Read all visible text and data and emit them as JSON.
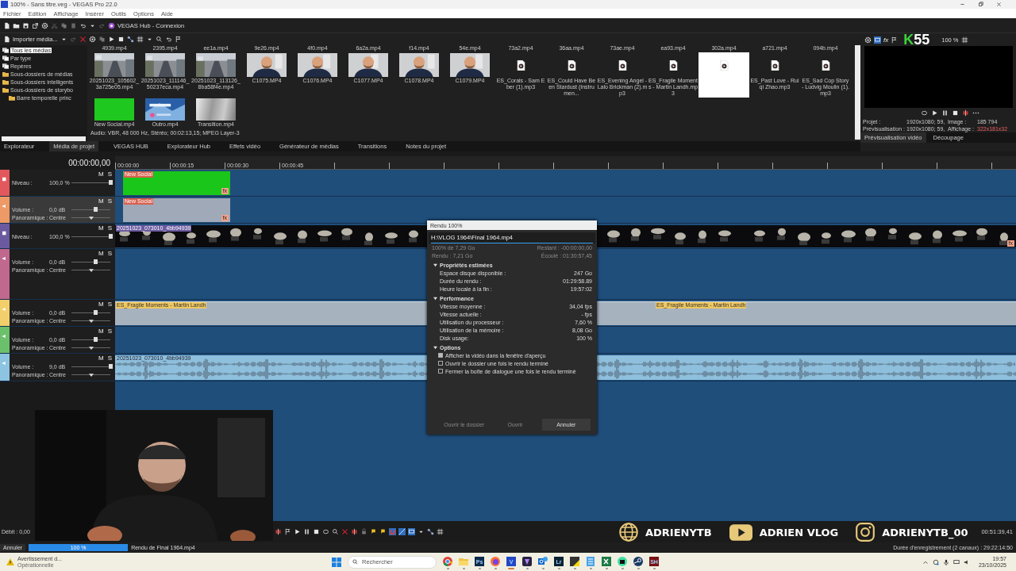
{
  "window": {
    "title": "100% - Sans titre.veg - VEGAS Pro 22.0"
  },
  "menu": [
    "Fichier",
    "Edition",
    "Affichage",
    "Insérer",
    "Outils",
    "Options",
    "Aide"
  ],
  "hub": {
    "label": "VEGAS Hub - Connexion"
  },
  "media": {
    "import_label": "Importer média...",
    "tree": [
      {
        "label": "Tous les médias",
        "kind": "stack",
        "selected": true
      },
      {
        "label": "Par type",
        "kind": "stack",
        "selected": false
      },
      {
        "label": "Repères",
        "kind": "stack",
        "selected": false
      },
      {
        "label": "Sous-dossiers de médias",
        "kind": "folder",
        "selected": false
      },
      {
        "label": "Sous-dossiers intelligents",
        "kind": "folder",
        "selected": false
      },
      {
        "label": "Sous-dossiers de storybo",
        "kind": "folder",
        "selected": false,
        "children": [
          {
            "label": "Barre temporelle princ",
            "kind": "folder",
            "selected": false
          }
        ]
      }
    ],
    "top_labels": [
      "4939.mp4",
      "2395.mp4",
      "ee1a.mp4",
      "9e26.mp4",
      "4f0.mp4",
      "6a2a.mp4",
      "f14.mp4",
      "54e.mp4",
      "73a2.mp4",
      "36aa.mp4",
      "73ae.mp4",
      "ea93.mp4",
      "302a.mp4",
      "a721.mp4",
      "094b.mp4"
    ],
    "rows": [
      [
        {
          "name": "20251023_105602_3a725e05.mp4",
          "kind": "picture",
          "selected": false
        },
        {
          "name": "20251023_111146_50237eca.mp4",
          "kind": "picture",
          "selected": false
        },
        {
          "name": "20251023_113126_8ba58f4e.mp4",
          "kind": "picture",
          "selected": false
        },
        {
          "name": "C1075.MP4",
          "kind": "picture",
          "selected": false
        },
        {
          "name": "C1076.MP4",
          "kind": "picture",
          "selected": false
        },
        {
          "name": "C1077.MP4",
          "kind": "picture",
          "selected": false
        },
        {
          "name": "C1078.MP4",
          "kind": "picture",
          "selected": false
        },
        {
          "name": "C1079.MP4",
          "kind": "picture",
          "selected": false
        },
        {
          "name": "ES_Corals - Sam Eber (1).mp3",
          "kind": "audio",
          "selected": false
        },
        {
          "name": "ES_Could Have Been Stardust (Instrumen...",
          "kind": "audio",
          "selected": false
        },
        {
          "name": "ES_Evening Angel - Lalo Brickman (2).mp3",
          "kind": "audio",
          "selected": false
        },
        {
          "name": "ES_Fragile Moments - Martin Landh.mp3",
          "kind": "audio",
          "selected": false
        },
        {
          "kind": "audio",
          "selected": true
        },
        {
          "name": "ES_Past Love - Ruiqi Zhao.mp3",
          "kind": "audio",
          "selected": false
        },
        {
          "name": "ES_Sad Cop Story - Ludvig Moulin (1).mp3",
          "kind": "audio",
          "selected": false
        }
      ],
      [
        {
          "name": "New Social.mp4",
          "kind": "solid",
          "color": "#1fc81f",
          "selected": false
        },
        {
          "name": "Outro.mp4",
          "kind": "picture",
          "selected": false
        },
        {
          "name": "Transition.mp4",
          "kind": "fade",
          "selected": false
        }
      ]
    ],
    "info": "Audio: VBR, 48 000 Hz, Stéréo; 00:02:13,15; MPEG Layer-3",
    "tabs": [
      {
        "label": "Explorateur",
        "selected": false
      },
      {
        "label": "Média de projet",
        "selected": true
      },
      {
        "label": "VEGAS HUB",
        "selected": false
      },
      {
        "label": "Explorateur Hub",
        "selected": false
      },
      {
        "label": "Effets vidéo",
        "selected": false
      },
      {
        "label": "Générateur de médias",
        "selected": false
      },
      {
        "label": "Transitions",
        "selected": false
      },
      {
        "label": "Notes du projet",
        "selected": false
      }
    ]
  },
  "preview": {
    "fx_label": "fx",
    "logo_k": "K",
    "logo_num": "55",
    "zoom": "100 %",
    "info": [
      {
        "label": "Projet :",
        "value": "1920x1080; 59,",
        "label2": "Image :",
        "value2": "185 794"
      },
      {
        "label": "Prévisualisation :",
        "value": "1920x1080; 59,",
        "label2": "Affichage :",
        "value2": "322x181x32"
      }
    ],
    "tabs": [
      {
        "label": "Prévisualisation vidéo",
        "selected": true
      },
      {
        "label": "Découpage",
        "selected": false
      }
    ]
  },
  "timeline": {
    "timecode": "00:00:00,00",
    "ruler": [
      "00:00:00",
      "00:00:15",
      "00:00:30",
      "00:00:45"
    ],
    "tracks": [
      {
        "kind": "video",
        "color": "#e2585c",
        "selected": false,
        "buttons": [
          "M",
          "S"
        ],
        "params": [
          {
            "kind": "slider",
            "label": "Niveau :",
            "value": "100,0 %",
            "level": 1
          }
        ],
        "clips": [
          {
            "kind": "solid",
            "name": "New Social",
            "badge": "fx"
          }
        ]
      },
      {
        "kind": "audio",
        "color": "#ee9a66",
        "selected": true,
        "buttons": [
          "M",
          "S"
        ],
        "params": [
          {
            "kind": "slider",
            "label": "Volume :",
            "value": "0,0 dB",
            "level": 0.62
          },
          {
            "kind": "pan",
            "label": "Panoramique :",
            "value": "Centre",
            "level": 0.5
          }
        ],
        "clips": [
          {
            "kind": "audio",
            "name": "New Social",
            "badge": "fx"
          }
        ]
      },
      {
        "kind": "video",
        "color": "#6b5aa0",
        "selected": false,
        "buttons": [
          "M",
          "S"
        ],
        "params": [
          {
            "kind": "slider",
            "label": "Niveau :",
            "value": "100,0 %",
            "level": 1
          }
        ],
        "clips": [
          {
            "kind": "footage",
            "name": "20251023_073010_4bb94939"
          },
          {
            "kind": "footage",
            "badge": "fx"
          }
        ]
      },
      {
        "kind": "audio",
        "color": "#c0688e",
        "selected": false,
        "buttons": [
          "M",
          "S"
        ],
        "params": [
          {
            "kind": "slider",
            "label": "Volume :",
            "value": "0,0 dB",
            "level": 0.62
          },
          {
            "kind": "pan",
            "label": "Panoramique :",
            "value": "Centre",
            "level": 0.5
          }
        ]
      },
      {
        "kind": "audio",
        "color": "#f2cf6a",
        "selected": false,
        "buttons": [
          "M",
          "S"
        ],
        "params": [
          {
            "kind": "slider",
            "label": "Volume :",
            "value": "0,0 dB",
            "level": 0.62
          },
          {
            "kind": "pan",
            "label": "Panoramique :",
            "value": "Centre",
            "level": 0.5
          }
        ],
        "clips": [
          {
            "kind": "music",
            "name": "ES_Fragile Moments - Martin Landh"
          },
          {
            "kind": "music",
            "name": "ES_Fragile Moments - Martin Landh"
          }
        ]
      },
      {
        "kind": "audio",
        "color": "#6cc06c",
        "selected": false,
        "buttons": [
          "M",
          "S"
        ],
        "params": [
          {
            "kind": "slider",
            "label": "Volume :",
            "value": "0,0 dB",
            "level": 0.62
          },
          {
            "kind": "pan",
            "label": "Panoramique :",
            "value": "Centre",
            "level": 0.5
          }
        ]
      },
      {
        "kind": "audio",
        "color": "#8cc4e2",
        "selected": false,
        "buttons": [
          "M",
          "S"
        ],
        "params": [
          {
            "kind": "slider",
            "label": "Volume :",
            "value": "9,0 dB",
            "level": 1
          },
          {
            "kind": "pan",
            "label": "Panoramique :",
            "value": "Centre",
            "level": 0.5
          }
        ],
        "clips": [
          {
            "kind": "waveform",
            "name": "20251023_073010_4bb94939"
          },
          {
            "kind": "waveform"
          }
        ]
      }
    ]
  },
  "render_dialog": {
    "title": "Rendu 100%",
    "path": "H:\\VLOG 1964\\Final 1964.mp4",
    "level": 1,
    "stats": [
      {
        "left": "100% de 7,29 Go",
        "right": "Restant : -00:00:00,00"
      },
      {
        "left": "Rendu : 7,21 Go",
        "right": "Écoulé : 01:30:57,45"
      }
    ],
    "sections": [
      {
        "title": "Propriétés estimées",
        "expanded": true,
        "rows": [
          {
            "label": "Espace disque disponible :",
            "value": "247 Go"
          },
          {
            "label": "Durée du rendu :",
            "value": "01:29:58.89"
          },
          {
            "label": "Heure locale à la fin :",
            "value": "19:57:02"
          }
        ]
      },
      {
        "title": "Performance",
        "expanded": true,
        "rows": [
          {
            "label": "Vitesse moyenne :",
            "value": "34,04 fps"
          },
          {
            "label": "Vitesse actuelle :",
            "value": "- fps"
          },
          {
            "label": "Utilisation du processeur :",
            "value": "7,60 %"
          },
          {
            "label": "Utilisation de la mémoire :",
            "value": "8,08 Go"
          },
          {
            "label": "Disk usage:",
            "value": "100 %"
          }
        ]
      },
      {
        "title": "Options",
        "expanded": true,
        "options": [
          {
            "label": "Afficher la vidéo dans la fenêtre d'aperçu",
            "checked": true
          },
          {
            "label": "Ouvrir le dossier une fois le rendu terminé",
            "checked": false
          },
          {
            "label": "Fermer la boîte de dialogue une fois le rendu terminé",
            "checked": false
          }
        ]
      }
    ],
    "buttons": [
      {
        "label": "Ouvrir le dossier",
        "disabled": true
      },
      {
        "label": "Ouvrir",
        "disabled": true
      },
      {
        "label": "Annuler",
        "disabled": false
      }
    ]
  },
  "bottom": {
    "rate": "Débit : 0,00",
    "end_time": "00:51:39,41",
    "cancel": "Annuler",
    "progress": {
      "level": 1,
      "text": "100 %"
    },
    "render_label": "Rendu de Final 1964.mp4",
    "recording": "Durée d'enregistrement (2 canaux) : 29:22:14:50"
  },
  "social": [
    {
      "kind": "web",
      "label": "ADRIENYTB"
    },
    {
      "kind": "youtube",
      "label": "ADRIEN VLOG"
    },
    {
      "kind": "instagram",
      "label": "ADRIENYTB_00"
    }
  ],
  "taskbar": {
    "notice_title": "Avertissement d...",
    "notice_status": "Opérationnelle",
    "search_placeholder": "Rechercher",
    "apps": [
      {
        "kind": "chrome",
        "selected": false
      },
      {
        "kind": "folder",
        "selected": false
      },
      {
        "kind": "tile",
        "glyph": "Ps",
        "color": "#0d2a4a",
        "selected": false
      },
      {
        "kind": "firefox",
        "selected": false
      },
      {
        "kind": "tile",
        "glyph": "V",
        "color": "#2447c4",
        "selected": true
      },
      {
        "kind": "shield",
        "selected": false
      },
      {
        "kind": "mail",
        "selected": false
      },
      {
        "kind": "tile",
        "glyph": "Lr",
        "color": "#0b2233",
        "selected": false
      },
      {
        "kind": "note",
        "selected": false
      },
      {
        "kind": "notepad",
        "selected": false
      },
      {
        "kind": "sheet",
        "selected": false
      },
      {
        "kind": "bot",
        "selected": false
      },
      {
        "kind": "steam",
        "selected": false
      },
      {
        "kind": "tile",
        "glyph": "SH",
        "color": "#7a1010",
        "selected": false
      }
    ],
    "time": "19:57",
    "date": "23/10/2025"
  }
}
